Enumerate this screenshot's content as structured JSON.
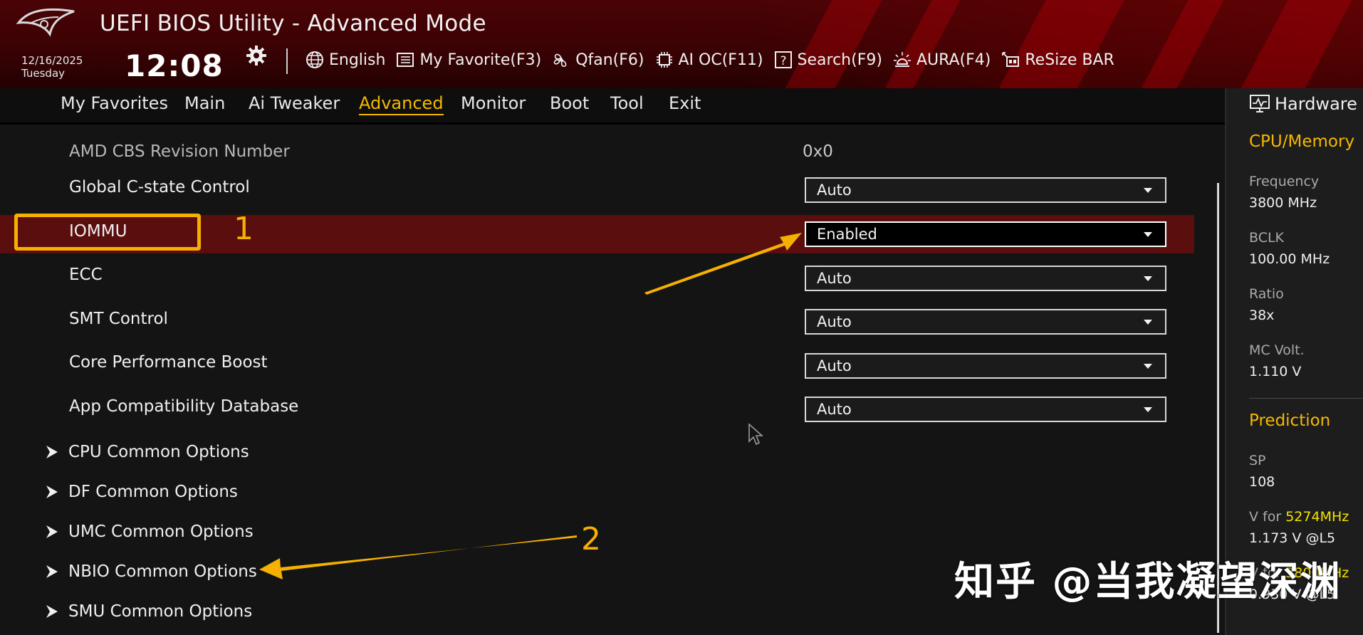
{
  "header": {
    "title": "UEFI BIOS Utility - Advanced Mode",
    "date": "12/16/2025",
    "weekday": "Tuesday",
    "time": "12:08",
    "toolbar": [
      {
        "label": "English",
        "icon": "globe-icon"
      },
      {
        "label": "My Favorite(F3)",
        "icon": "favorite-list-icon"
      },
      {
        "label": "Qfan(F6)",
        "icon": "fan-icon"
      },
      {
        "label": "AI OC(F11)",
        "icon": "ai-chip-icon"
      },
      {
        "label": "Search(F9)",
        "icon": "search-help-icon"
      },
      {
        "label": "AURA(F4)",
        "icon": "aura-light-icon"
      },
      {
        "label": "ReSize BAR",
        "icon": "resize-bar-icon"
      }
    ]
  },
  "menu": {
    "items": [
      "My Favorites",
      "Main",
      "Ai Tweaker",
      "Advanced",
      "Monitor",
      "Boot",
      "Tool",
      "Exit"
    ],
    "active": "Advanced"
  },
  "settings": {
    "info_row": {
      "label": "AMD CBS Revision Number",
      "value": "0x0"
    },
    "rows": [
      {
        "label": "Global C-state Control",
        "value": "Auto"
      },
      {
        "label": "IOMMU",
        "value": "Enabled"
      },
      {
        "label": "ECC",
        "value": "Auto"
      },
      {
        "label": "SMT Control",
        "value": "Auto"
      },
      {
        "label": "Core Performance Boost",
        "value": "Auto"
      },
      {
        "label": "App Compatibility Database",
        "value": "Auto"
      }
    ],
    "submenus": [
      "CPU Common Options",
      "DF Common Options",
      "UMC Common Options",
      "NBIO Common Options",
      "SMU Common Options"
    ]
  },
  "hardware": {
    "title": "Hardware M",
    "cpu_memory": {
      "heading": "CPU/Memory",
      "frequency_label": "Frequency",
      "frequency_value": "3800 MHz",
      "bclk_label": "BCLK",
      "bclk_value": "100.00 MHz",
      "ratio_label": "Ratio",
      "ratio_value": "38x",
      "mc_volt_label": "MC Volt.",
      "mc_volt_value": "1.110 V"
    },
    "prediction": {
      "heading": "Prediction",
      "sp_label": "SP",
      "sp_value": "108",
      "v_for_label": "V for",
      "v_for_freq": "5274MHz",
      "v_for_value": "1.173 V @L5",
      "v2_label": "V for",
      "v2_freq": "3800MHz",
      "v2_value": "0.930 V @L5"
    }
  },
  "annotations": {
    "step1": "1",
    "step2": "2",
    "color": "#f5b000"
  },
  "watermark": "知乎 @当我凝望深渊",
  "colors": {
    "accent": "#f5b800",
    "highlight_row": "#5a0e0e",
    "header": "#3a0204"
  }
}
